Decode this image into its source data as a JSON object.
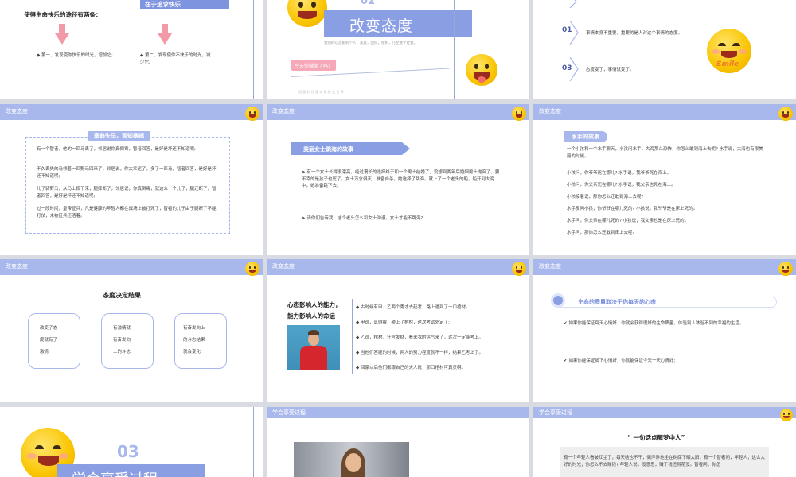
{
  "colors": {
    "accent": "#a9b8ec",
    "accent_dark": "#7a8fdc",
    "divider": "#d9dbe3",
    "text": "#333333"
  },
  "s1": {
    "label": "在于追求快乐",
    "heading": "使得生命快乐的途径有两条：",
    "left": "◆ 第一、发现使你快乐的时光，增加它;",
    "right": "◆ 第二、发现使你不快乐的时光，减少它。"
  },
  "s2": {
    "number": "02",
    "title": "改变态度",
    "sub": "我们的心态影响个人，家庭，团队，组织，乃至整个社会。",
    "pill": "今天你微笑了吗?",
    "foot": "用 我 们 在 读 实 际 改 变 世 界"
  },
  "s3": {
    "items": [
      {
        "num": "01",
        "text": "事情本身不重要，重要的是人对这个事情的态度。"
      },
      {
        "num": "03",
        "text": "态度变了，事情就变了。"
      }
    ],
    "smile_text": "Smile"
  },
  "s4": {
    "header": "改变态度",
    "title": "塞翁失马，焉知祸福",
    "p1": "有一个智者，他的一匹马丢了，邻居说你真倒霉，智者回答，是好是坏还不知道呢;",
    "p2": "不久丢失的马领着一匹野马回来了，邻居说，你太幸运了，多了一匹马，智者回答，是好是坏还不知道呢;",
    "p3": "儿子骑野马，从马上摔下来，腿摔断了，邻居说，你真倒霉，就这么一个儿子，腿还断了，智者回答，是好是坏还不知道呢;",
    "p4": "过一段时间，皇帝征兵，凡是健康的年轻人都在战场上被打死了，智者的儿子由于腿断了不能打仗，未被征兵还活着。"
  },
  "s5": {
    "header": "改变态度",
    "title": "美丽女士跳海的故事",
    "p1": "➤ 有一个女士长得很漂亮，经过漫长的选择终于和一个男士结婚了，没想到两年后婚姻男士抛弃了，要不幸的是孩子也死了。女士万念俱灭，准备自杀。她选择了跳海。就上了一个老头的船，船开到大海中，她准备跳下去。",
    "p2": "➤ 请你们告诉我，这个老头怎么和女士沟通，女士才能不跳海?"
  },
  "s6": {
    "header": "改变态度",
    "title": "水手的故事",
    "lines": [
      "一个小孩和一个水手聊天，小孩问水手，大海那么恐怖，你怎么敢到海上去呢? 水手说，大海也有很美丽的时候。",
      "小孩问，你爷爷死在哪儿? 水手说，我爷爷死在海上。",
      "小孩问，你父亲死在哪儿? 水手说，我父亲也死在海上。",
      "小孩接着说，那你怎么还敢到海上去呢?",
      "水手反问小孩，你爷爷在哪儿死的? 小孩说，我爷爷是在床上死的。",
      "水手问，你父亲在哪儿死的? 小孩说，我父亲也是在床上死的。",
      "水手问，那你怎么还敢到床上去呢?"
    ]
  },
  "s7": {
    "header": "改变态度",
    "title": "态度决定结果",
    "boxes": [
      [
        "改变了态",
        "度就有了",
        "激情"
      ],
      [
        "有激情就",
        "有奋发向",
        "上的斗志"
      ],
      [
        "有奋发向上",
        "的斗志结果",
        "就会变化"
      ]
    ]
  },
  "s8": {
    "header": "改变态度",
    "title1": "心态影响人的能力，",
    "title2": "能力影响人的命运",
    "items": [
      "◆ 古时候有甲、乙两个秀才去赶考，路上遇到了一口棺材。",
      "◆ 甲说，真倒霉，碰上了棺材，这次考试死定了;",
      "◆ 乙说，棺材，升官发财，看来我的运气来了，这次一定能考上。",
      "◆ 当他们答题的时候，两人的努力程度就不一样，结果乙考上了。",
      "◆ 回家以后他们都跟自己的夫人说，那口棺材可真灵啊。"
    ]
  },
  "s9": {
    "header": "改变态度",
    "title": "生命的质量取决于你每天的心态",
    "p1": "✔ 如果你能保证每天心情好，你就会获得很好的生命质量，体验到人体验不到的幸福的生活。",
    "p2": "✔ 如果你能保证脚下心情好，你就能保证今天一天心情好;"
  },
  "s10": {
    "number": "03",
    "title": "学会享受过程"
  },
  "s11": {
    "header": "学会享受过程"
  },
  "s12": {
    "header": "学会享受过程",
    "title": "“ 一句话点醒梦中人”",
    "p1": "有一个年轻人看破红尘了，每天啥也不干，懒洋洋地坐在树底下晒太阳，有一个智者问，年轻人，这么大好的时光，你怎么不去赚钱? 年轻人说，没意思，赚了钱还得花没。智者问，你怎"
  }
}
